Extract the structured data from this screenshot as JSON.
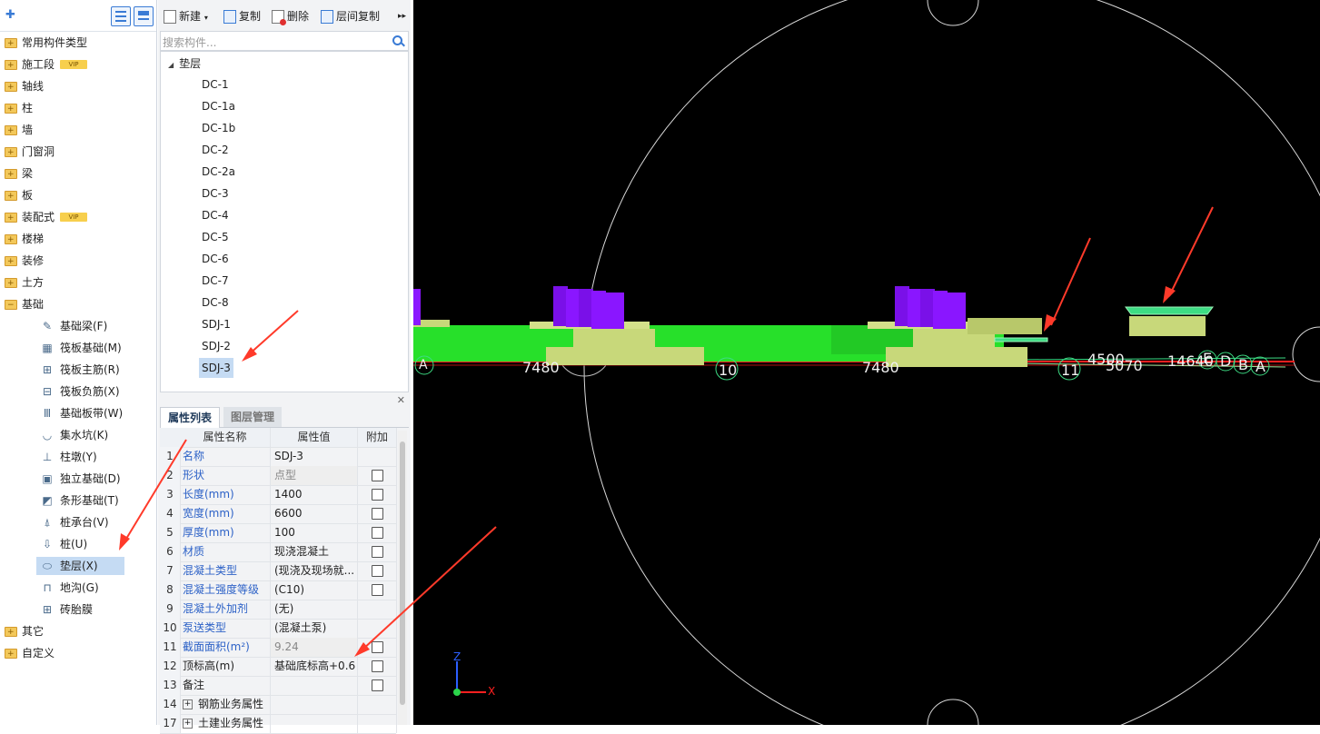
{
  "left_tree": {
    "categories": [
      {
        "label": "常用构件类型",
        "vip": false
      },
      {
        "label": "施工段",
        "vip": true
      },
      {
        "label": "轴线",
        "vip": false
      },
      {
        "label": "柱",
        "vip": false
      },
      {
        "label": "墙",
        "vip": false
      },
      {
        "label": "门窗洞",
        "vip": false
      },
      {
        "label": "梁",
        "vip": false
      },
      {
        "label": "板",
        "vip": false
      },
      {
        "label": "装配式",
        "vip": true
      },
      {
        "label": "楼梯",
        "vip": false
      },
      {
        "label": "装修",
        "vip": false
      },
      {
        "label": "土方",
        "vip": false
      },
      {
        "label": "基础",
        "vip": false
      }
    ],
    "vip_label": "VIP",
    "foundation_items": [
      {
        "label": "基础梁(F)",
        "icon": "beam-icon"
      },
      {
        "label": "筏板基础(M)",
        "icon": "raft-icon"
      },
      {
        "label": "筏板主筋(R)",
        "icon": "raft-main-rebar-icon"
      },
      {
        "label": "筏板负筋(X)",
        "icon": "raft-neg-rebar-icon"
      },
      {
        "label": "基础板带(W)",
        "icon": "slab-strip-icon"
      },
      {
        "label": "集水坑(K)",
        "icon": "sump-icon"
      },
      {
        "label": "柱墩(Y)",
        "icon": "column-pier-icon"
      },
      {
        "label": "独立基础(D)",
        "icon": "isolated-footing-icon"
      },
      {
        "label": "条形基础(T)",
        "icon": "strip-footing-icon"
      },
      {
        "label": "桩承台(V)",
        "icon": "pile-cap-icon"
      },
      {
        "label": "桩(U)",
        "icon": "pile-icon"
      },
      {
        "label": "垫层(X)",
        "icon": "cushion-icon"
      },
      {
        "label": "地沟(G)",
        "icon": "trench-icon"
      },
      {
        "label": "砖胎膜",
        "icon": "brick-mold-icon"
      }
    ],
    "tail": [
      {
        "label": "其它"
      },
      {
        "label": "自定义"
      }
    ]
  },
  "toolbar": {
    "new_label": "新建",
    "copy_label": "复制",
    "delete_label": "删除",
    "floor_copy_label": "层间复制",
    "more": "▸▸"
  },
  "search": {
    "placeholder": "搜索构件..."
  },
  "component_list": {
    "root": "垫层",
    "items": [
      "DC-1",
      "DC-1a",
      "DC-1b",
      "DC-2",
      "DC-2a",
      "DC-3",
      "DC-4",
      "DC-5",
      "DC-6",
      "DC-7",
      "DC-8",
      "SDJ-1",
      "SDJ-2",
      "SDJ-3"
    ],
    "selected": "SDJ-3"
  },
  "properties": {
    "tab_active": "属性列表",
    "tab_inactive": "图层管理",
    "headers": {
      "name": "属性名称",
      "value": "属性值",
      "add": "附加"
    },
    "rows": [
      {
        "idx": "1",
        "name": "名称",
        "value": "SDJ-3",
        "blue": true,
        "checkbox": false,
        "disabled": false
      },
      {
        "idx": "2",
        "name": "形状",
        "value": "点型",
        "blue": true,
        "checkbox": true,
        "disabled": true
      },
      {
        "idx": "3",
        "name": "长度(mm)",
        "value": "1400",
        "blue": true,
        "checkbox": true,
        "disabled": false
      },
      {
        "idx": "4",
        "name": "宽度(mm)",
        "value": "6600",
        "blue": true,
        "checkbox": true,
        "disabled": false
      },
      {
        "idx": "5",
        "name": "厚度(mm)",
        "value": "100",
        "blue": true,
        "checkbox": true,
        "disabled": false
      },
      {
        "idx": "6",
        "name": "材质",
        "value": "现浇混凝土",
        "blue": true,
        "checkbox": true,
        "disabled": false
      },
      {
        "idx": "7",
        "name": "混凝土类型",
        "value": "(现浇及现场就...",
        "blue": true,
        "checkbox": true,
        "disabled": false
      },
      {
        "idx": "8",
        "name": "混凝土强度等级",
        "value": "(C10)",
        "blue": true,
        "checkbox": true,
        "disabled": false
      },
      {
        "idx": "9",
        "name": "混凝土外加剂",
        "value": "(无)",
        "blue": true,
        "checkbox": false,
        "disabled": false
      },
      {
        "idx": "10",
        "name": "泵送类型",
        "value": "(混凝土泵)",
        "blue": true,
        "checkbox": false,
        "disabled": false
      },
      {
        "idx": "11",
        "name": "截面面积(m²)",
        "value": "9.24",
        "blue": true,
        "checkbox": true,
        "disabled": true
      },
      {
        "idx": "12",
        "name": "顶标高(m)",
        "value": "基础底标高+0.6",
        "blue": false,
        "checkbox": true,
        "disabled": false
      },
      {
        "idx": "13",
        "name": "备注",
        "value": "",
        "blue": false,
        "checkbox": true,
        "disabled": false
      },
      {
        "idx": "14",
        "name": "钢筋业务属性",
        "value": "",
        "blue": false,
        "checkbox": false,
        "disabled": false,
        "expand": true
      },
      {
        "idx": "17",
        "name": "土建业务属性",
        "value": "",
        "blue": false,
        "checkbox": false,
        "disabled": false,
        "expand": true
      }
    ]
  },
  "viewport": {
    "labels": {
      "a1": "A",
      "d7480a": "7480",
      "axis10": "10",
      "d7480b": "7480",
      "axis11": "11",
      "d45": "4500",
      "d5070": "5070",
      "d14640": "14640",
      "E": "E",
      "D": "D",
      "B": "B",
      "A": "A"
    },
    "axis_labels": {
      "z": "Z",
      "x": "X"
    },
    "colors": {
      "slab": "#27e02a",
      "cushion": "#c8d87a",
      "column": "#8a16ff",
      "axis_line": "#ff2020",
      "highlight": "#3ddc84",
      "arrow": "#ff3a2a"
    }
  }
}
